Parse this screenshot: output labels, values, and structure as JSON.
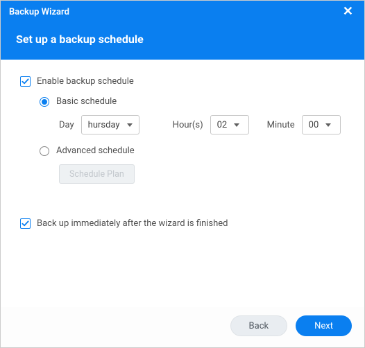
{
  "window": {
    "title": "Backup Wizard"
  },
  "header": {
    "title": "Set up a backup schedule"
  },
  "enable": {
    "label": "Enable backup schedule",
    "checked": true
  },
  "basic": {
    "label": "Basic schedule",
    "selected": true,
    "day_label": "Day",
    "day_value": "hursday",
    "hours_label": "Hour(s)",
    "hours_value": "02",
    "minute_label": "Minute",
    "minute_value": "00"
  },
  "advanced": {
    "label": "Advanced schedule",
    "selected": false,
    "plan_button": "Schedule Plan"
  },
  "immediate": {
    "label": "Back up immediately after the wizard is finished",
    "checked": true
  },
  "footer": {
    "back": "Back",
    "next": "Next"
  }
}
